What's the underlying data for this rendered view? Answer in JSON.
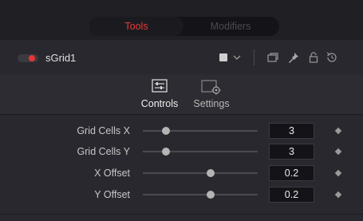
{
  "tabs": [
    {
      "label": "Tools",
      "active": true
    },
    {
      "label": "Modifiers",
      "active": false
    }
  ],
  "node": {
    "name": "sGrid1",
    "enabled": true,
    "icons": [
      "color-swatch-icon",
      "chevron-down-icon",
      "windows-icon",
      "pin-icon",
      "lock-icon",
      "reset-icon"
    ]
  },
  "subtabs": [
    {
      "label": "Controls",
      "icon": "controls-icon",
      "active": true
    },
    {
      "label": "Settings",
      "icon": "settings-icon",
      "active": false
    }
  ],
  "params": [
    {
      "label": "Grid Cells X",
      "value": "3",
      "slider": 0.2
    },
    {
      "label": "Grid Cells Y",
      "value": "3",
      "slider": 0.2
    },
    {
      "label": "X Offset",
      "value": "0.2",
      "slider": 0.59
    },
    {
      "label": "Y Offset",
      "value": "0.2",
      "slider": 0.59
    }
  ],
  "colors": {
    "accent": "#e4393c",
    "background": "#28282e",
    "field": "#141418"
  }
}
